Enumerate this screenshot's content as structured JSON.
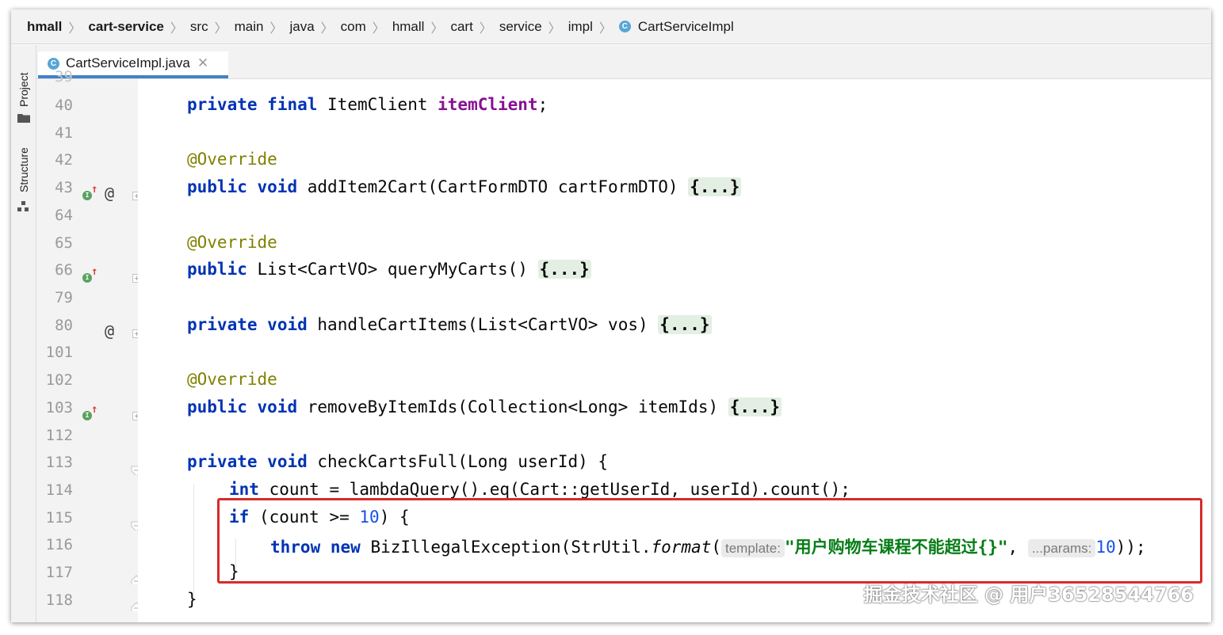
{
  "breadcrumb": {
    "items": [
      "hmall",
      "cart-service",
      "src",
      "main",
      "java",
      "com",
      "hmall",
      "cart",
      "service",
      "impl"
    ],
    "last_icon": "C",
    "last": "CartServiceImpl"
  },
  "tool_window": {
    "project_label": "Project",
    "structure_label": "Structure"
  },
  "tab": {
    "icon": "C",
    "label": "CartServiceImpl.java",
    "close": "✕"
  },
  "editor": {
    "line_numbers": [
      "40",
      "41",
      "42",
      "43",
      "64",
      "65",
      "66",
      "79",
      "80",
      "101",
      "102",
      "103",
      "112",
      "113",
      "114",
      "115",
      "116",
      "117",
      "118"
    ],
    "lines": {
      "l40": {
        "kw1": "private",
        "kw2": "final",
        "type": "ItemClient",
        "field": "itemClient",
        "end": ";"
      },
      "l42": {
        "ann": "@Override"
      },
      "l43": {
        "kw1": "public",
        "kw2": "void",
        "sig": "addItem2Cart(CartFormDTO cartFormDTO)",
        "fold": "{...}"
      },
      "l65": {
        "ann": "@Override"
      },
      "l66": {
        "kw1": "public",
        "sig": "List<CartVO> queryMyCarts()",
        "fold": "{...}"
      },
      "l80": {
        "kw1": "private",
        "kw2": "void",
        "sig": "handleCartItems(List<CartVO> vos)",
        "fold": "{...}"
      },
      "l102": {
        "ann": "@Override"
      },
      "l103": {
        "kw1": "public",
        "kw2": "void",
        "sig": "removeByItemIds(Collection<Long> itemIds)",
        "fold": "{...}"
      },
      "l113": {
        "kw1": "private",
        "kw2": "void",
        "sig": "checkCartsFull(Long userId) {"
      },
      "l114": {
        "kw1": "int",
        "rest": "count = lambdaQuery().eq(Cart::getUserId, userId).count();"
      },
      "l115": {
        "kw1": "if",
        "pre": "(count >= ",
        "num": "10",
        "post": ") {"
      },
      "l116": {
        "kw1": "throw",
        "kw2": "new",
        "pre": "BizIllegalException(StrUtil.",
        "method": "format",
        "paren": "(",
        "hint1": "template:",
        "str": "\"用户购物车课程不能超过{}\"",
        "comma": ",",
        "hint2": "...params:",
        "num": "10",
        "end": "));"
      },
      "l117": {
        "text": "}"
      },
      "l118": {
        "text": "}"
      }
    }
  },
  "watermark": "掘金技术社区 @ 用户36528544766"
}
